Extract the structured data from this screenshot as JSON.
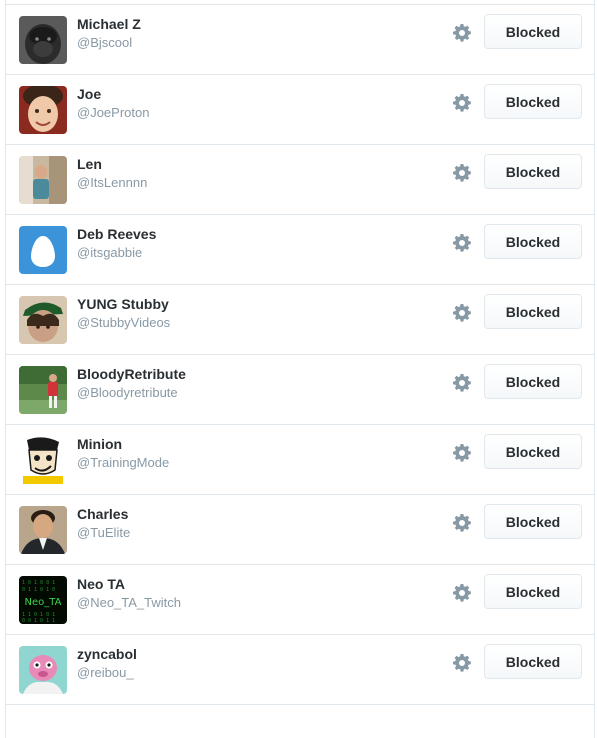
{
  "button_label": "Blocked",
  "users": [
    {
      "name": "Michael Z",
      "handle": "@Bjscool",
      "avatar": "gorilla"
    },
    {
      "name": "Joe",
      "handle": "@JoeProton",
      "avatar": "face-photo"
    },
    {
      "name": "Len",
      "handle": "@ItsLennnn",
      "avatar": "mirror-selfie"
    },
    {
      "name": "Deb Reeves",
      "handle": "@itsgabbie",
      "avatar": "default-egg"
    },
    {
      "name": "YUNG Stubby",
      "handle": "@StubbyVideos",
      "avatar": "cap-selfie"
    },
    {
      "name": "BloodyRetribute",
      "handle": "@Bloodyretribute",
      "avatar": "golfer"
    },
    {
      "name": "Minion",
      "handle": "@TrainingMode",
      "avatar": "cartoon-face"
    },
    {
      "name": "Charles",
      "handle": "@TuElite",
      "avatar": "suit-portrait"
    },
    {
      "name": "Neo TA",
      "handle": "@Neo_TA_Twitch",
      "avatar": "matrix-text",
      "avatar_text": "Neo_TA"
    },
    {
      "name": "zyncabol",
      "handle": "@reibou_",
      "avatar": "pink-cartoon"
    }
  ],
  "colors": {
    "name_text": "#292f33",
    "handle_text": "#8899a6",
    "divider": "#e1e8ed",
    "gear": "#8899a6",
    "egg_bg": "#3b94d9"
  }
}
